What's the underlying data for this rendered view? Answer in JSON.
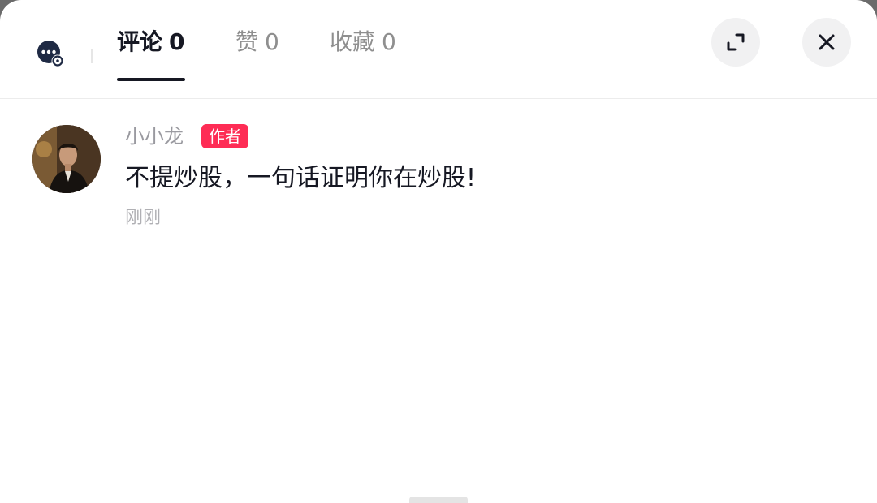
{
  "header": {
    "tabs": [
      {
        "label": "评论",
        "count": "0",
        "active": true
      },
      {
        "label": "赞",
        "count": "0",
        "active": false
      },
      {
        "label": "收藏",
        "count": "0",
        "active": false
      }
    ],
    "icons": {
      "settings": "comment-settings-icon",
      "expand": "expand-icon",
      "close": "close-icon"
    }
  },
  "comments": [
    {
      "author": "小小龙",
      "badge": "作者",
      "text": "不提炒股，一句话证明你在炒股!",
      "time": "刚刚"
    }
  ],
  "colors": {
    "badge": "#fe2c55",
    "text_primary": "#161823",
    "text_secondary": "#8f8f8f"
  }
}
